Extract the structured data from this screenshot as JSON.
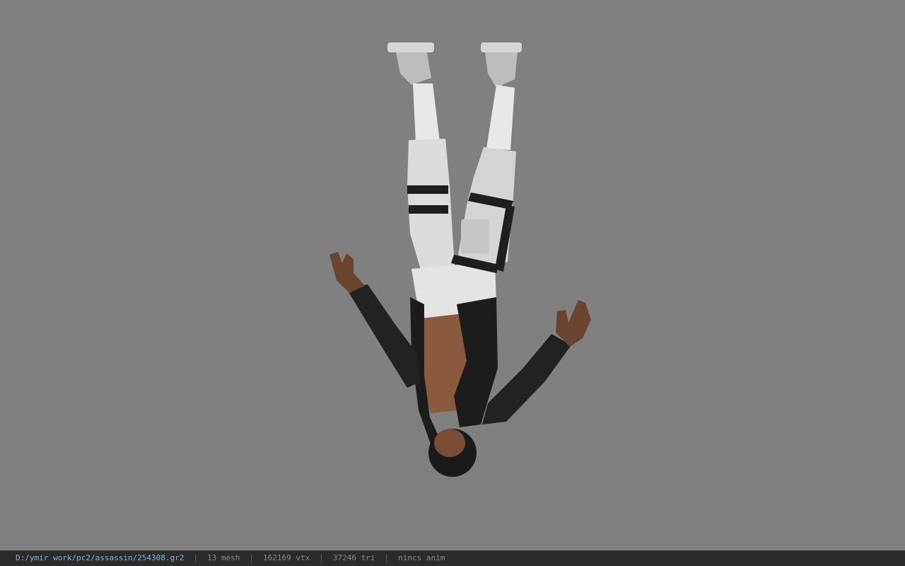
{
  "window": {
    "background_color": "#808080"
  },
  "viewport": {
    "model_icon": "upside-down-character-model"
  },
  "statusbar": {
    "file_path": "D:/ymir work/pc2/assassin/254308.gr2",
    "separator": "|",
    "mesh_count": "13 mesh",
    "vertex_count": "162169 vtx",
    "triangle_count": "37246 tri",
    "anim_status": "nincs anim",
    "path_color": "#7fb8d8",
    "bar_color": "#2b2b2b"
  }
}
